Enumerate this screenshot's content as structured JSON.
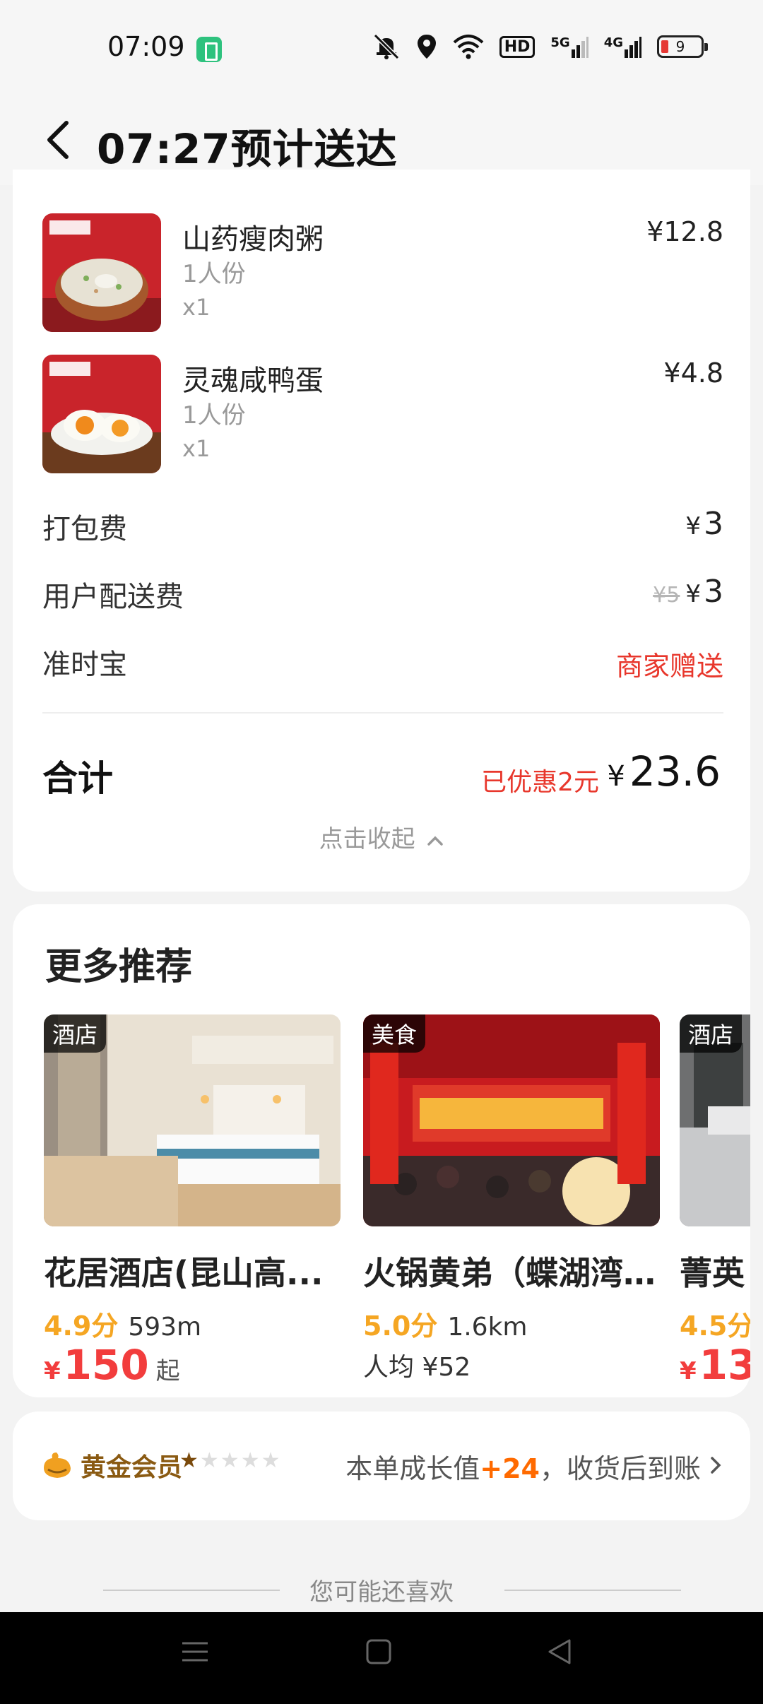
{
  "status_bar": {
    "time": "07:09",
    "hd_label": "HD",
    "net1": "5G",
    "net2": "4G",
    "battery": "9"
  },
  "header": {
    "title": "07:27预计送达"
  },
  "order": {
    "items": [
      {
        "name": "山药瘦肉粥",
        "spec": "1人份",
        "qty": "x1",
        "price": "¥12.8"
      },
      {
        "name": "灵魂咸鸭蛋",
        "spec": "1人份",
        "qty": "x1",
        "price": "¥4.8"
      }
    ],
    "fees": {
      "packing_label": "打包费",
      "packing_yen": "¥",
      "packing_value": "3",
      "delivery_label": "用户配送费",
      "delivery_original": "¥5",
      "delivery_yen": "¥",
      "delivery_value": "3",
      "ontime_label": "准时宝",
      "ontime_value": "商家赠送"
    },
    "total": {
      "label": "合计",
      "discount": "已优惠2元",
      "yen": "¥",
      "amount": "23.6"
    },
    "collapse_label": "点击收起"
  },
  "recommend": {
    "title": "更多推荐",
    "cards": [
      {
        "tag": "酒店",
        "name": "花居酒店(昆山高...",
        "score": "4.9分",
        "distance": "593m",
        "yen": "¥",
        "price": "150",
        "unit": "起"
      },
      {
        "tag": "美食",
        "name": "火锅黄弟（蝶湖湾...",
        "score": "5.0分",
        "distance": "1.6km",
        "avg": "人均 ¥52"
      },
      {
        "tag": "酒店",
        "name": "菁英",
        "score": "4.5分",
        "yen": "¥",
        "price": "13"
      }
    ]
  },
  "member": {
    "name": "黄金会员",
    "stars_on": "★",
    "stars_off": "★★★★",
    "info_prefix": "本单成长值",
    "info_plus": "+24",
    "info_suffix": "，收货后到账"
  },
  "you_may_like": "您可能还喜欢",
  "colors": {
    "accent_red": "#e8372c",
    "price_red": "#f23d3d",
    "score_orange": "#f5a623",
    "member_gold": "#8a5a12"
  }
}
